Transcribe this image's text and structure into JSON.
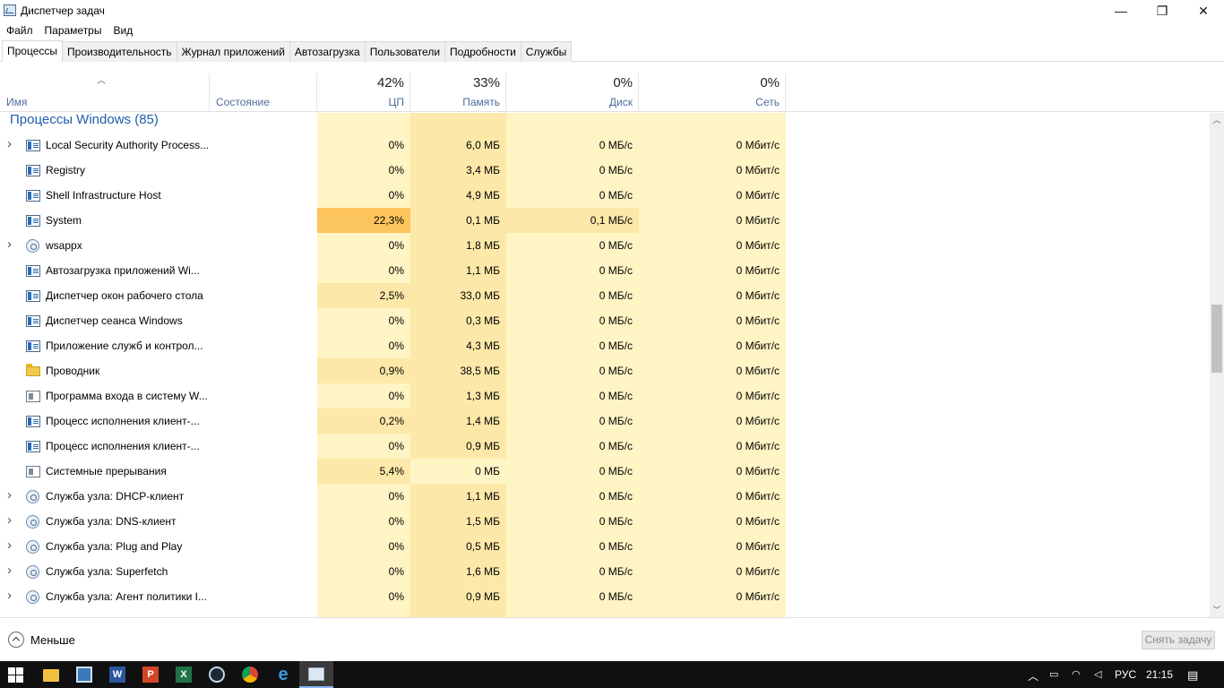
{
  "window": {
    "title": "Диспетчер задач",
    "minimize_glyph": "—",
    "maximize_glyph": "❐",
    "close_glyph": "✕"
  },
  "menu": [
    "Файл",
    "Параметры",
    "Вид"
  ],
  "tabs": [
    "Процессы",
    "Производительность",
    "Журнал приложений",
    "Автозагрузка",
    "Пользователи",
    "Подробности",
    "Службы"
  ],
  "active_tab": "Процессы",
  "header": {
    "name": "Имя",
    "status": "Состояние",
    "cpu_pct": "42%",
    "cpu": "ЦП",
    "mem_pct": "33%",
    "mem": "Память",
    "disk_pct": "0%",
    "disk": "Диск",
    "net_pct": "0%",
    "net": "Сеть"
  },
  "group": {
    "title": "Процессы Windows (85)"
  },
  "processes": [
    {
      "expander": true,
      "icon": "window",
      "name": "Local Security Authority Process...",
      "cpu": "0%",
      "mem": "6,0 МБ",
      "disk": "0 МБ/с",
      "net": "0 Мбит/с"
    },
    {
      "expander": false,
      "icon": "window",
      "name": "Registry",
      "cpu": "0%",
      "mem": "3,4 МБ",
      "disk": "0 МБ/с",
      "net": "0 Мбит/с"
    },
    {
      "expander": false,
      "icon": "window",
      "name": "Shell Infrastructure Host",
      "cpu": "0%",
      "mem": "4,9 МБ",
      "disk": "0 МБ/с",
      "net": "0 Мбит/с"
    },
    {
      "expander": false,
      "icon": "window",
      "name": "System",
      "cpu": "22,3%",
      "mem": "0,1 МБ",
      "disk": "0,1 МБ/с",
      "net": "0 Мбит/с"
    },
    {
      "expander": true,
      "icon": "gear",
      "name": "wsappx",
      "cpu": "0%",
      "mem": "1,8 МБ",
      "disk": "0 МБ/с",
      "net": "0 Мбит/с"
    },
    {
      "expander": false,
      "icon": "window",
      "name": "Автозагрузка приложений Wi...",
      "cpu": "0%",
      "mem": "1,1 МБ",
      "disk": "0 МБ/с",
      "net": "0 Мбит/с"
    },
    {
      "expander": false,
      "icon": "window",
      "name": "Диспетчер окон рабочего стола",
      "cpu": "2,5%",
      "mem": "33,0 МБ",
      "disk": "0 МБ/с",
      "net": "0 Мбит/с"
    },
    {
      "expander": false,
      "icon": "window",
      "name": "Диспетчер сеанса  Windows",
      "cpu": "0%",
      "mem": "0,3 МБ",
      "disk": "0 МБ/с",
      "net": "0 Мбит/с"
    },
    {
      "expander": false,
      "icon": "window",
      "name": "Приложение служб и контрол...",
      "cpu": "0%",
      "mem": "4,3 МБ",
      "disk": "0 МБ/с",
      "net": "0 Мбит/с"
    },
    {
      "expander": false,
      "icon": "folder",
      "name": "Проводник",
      "cpu": "0,9%",
      "mem": "38,5 МБ",
      "disk": "0 МБ/с",
      "net": "0 Мбит/с"
    },
    {
      "expander": false,
      "icon": "system",
      "name": "Программа входа в систему W...",
      "cpu": "0%",
      "mem": "1,3 МБ",
      "disk": "0 МБ/с",
      "net": "0 Мбит/с"
    },
    {
      "expander": false,
      "icon": "window",
      "name": "Процесс исполнения клиент-...",
      "cpu": "0,2%",
      "mem": "1,4 МБ",
      "disk": "0 МБ/с",
      "net": "0 Мбит/с"
    },
    {
      "expander": false,
      "icon": "window",
      "name": "Процесс исполнения клиент-...",
      "cpu": "0%",
      "mem": "0,9 МБ",
      "disk": "0 МБ/с",
      "net": "0 Мбит/с"
    },
    {
      "expander": false,
      "icon": "system",
      "name": "Системные прерывания",
      "cpu": "5,4%",
      "mem": "0 МБ",
      "disk": "0 МБ/с",
      "net": "0 Мбит/с"
    },
    {
      "expander": true,
      "icon": "gear",
      "name": "Служба узла: DHCP-клиент",
      "cpu": "0%",
      "mem": "1,1 МБ",
      "disk": "0 МБ/с",
      "net": "0 Мбит/с"
    },
    {
      "expander": true,
      "icon": "gear",
      "name": "Служба узла: DNS-клиент",
      "cpu": "0%",
      "mem": "1,5 МБ",
      "disk": "0 МБ/с",
      "net": "0 Мбит/с"
    },
    {
      "expander": true,
      "icon": "gear",
      "name": "Служба узла: Plug and Play",
      "cpu": "0%",
      "mem": "0,5 МБ",
      "disk": "0 МБ/с",
      "net": "0 Мбит/с"
    },
    {
      "expander": true,
      "icon": "gear",
      "name": "Служба узла: Superfetch",
      "cpu": "0%",
      "mem": "1,6 МБ",
      "disk": "0 МБ/с",
      "net": "0 Мбит/с"
    },
    {
      "expander": true,
      "icon": "gear",
      "name": "Служба узла: Агент политики I...",
      "cpu": "0%",
      "mem": "0,9 МБ",
      "disk": "0 МБ/с",
      "net": "0 Мбит/с"
    }
  ],
  "footer": {
    "less_label": "Меньше",
    "end_task_label": "Снять задачу"
  },
  "taskbar": {
    "apps": [
      "start-button",
      "file-explorer",
      "network-app",
      "word",
      "powerpoint",
      "excel",
      "steam",
      "chrome",
      "edge",
      "task-manager"
    ],
    "language": "РУС",
    "time": "21:15"
  },
  "colors": {
    "heat_low": "#fff4c4",
    "heat_mid": "#fce8a8",
    "heat_high": "#fcc45c",
    "group_title": "#1e5eaa",
    "header_label": "#4c6c9c"
  }
}
